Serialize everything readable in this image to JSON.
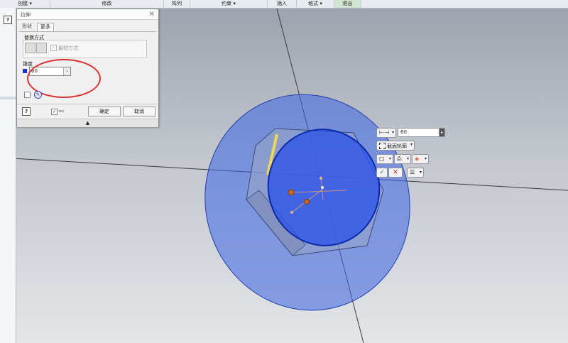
{
  "ribbon": {
    "sections": [
      {
        "label": "创建 ▾"
      },
      {
        "label": "修改"
      },
      {
        "label": "阵列"
      },
      {
        "label": "约束 ▾"
      },
      {
        "label": "插入"
      },
      {
        "label": "格式 ▾"
      },
      {
        "label": "退出"
      }
    ]
  },
  "left_panel": {
    "help_icon": "?"
  },
  "dialog": {
    "title": "拉伸",
    "close_glyph": "×",
    "tabs": [
      {
        "label": "形状"
      },
      {
        "label": "更多"
      }
    ],
    "alt_solution": {
      "label": "替换方式",
      "option_label": "最短方式",
      "option_checked": true
    },
    "width": {
      "label": "锥度",
      "value": "60",
      "arrow": "›",
      "swatch_color": "#1a2fd6"
    },
    "help_glyph": "?",
    "preview_checked": true,
    "ok_label": "确定",
    "cancel_label": "取消",
    "expander_glyph": "▲"
  },
  "minitoolbar": {
    "distance_value": "60",
    "arrow_glyph": "▸",
    "profile_label": "截面轮廓",
    "ok_glyph": "✓",
    "cancel_glyph": "✕"
  },
  "colors": {
    "accent_blue": "#1a2fd6",
    "annotation_red": "#d93030",
    "ok_green": "#1a8a1a",
    "cancel_red": "#d01010"
  }
}
